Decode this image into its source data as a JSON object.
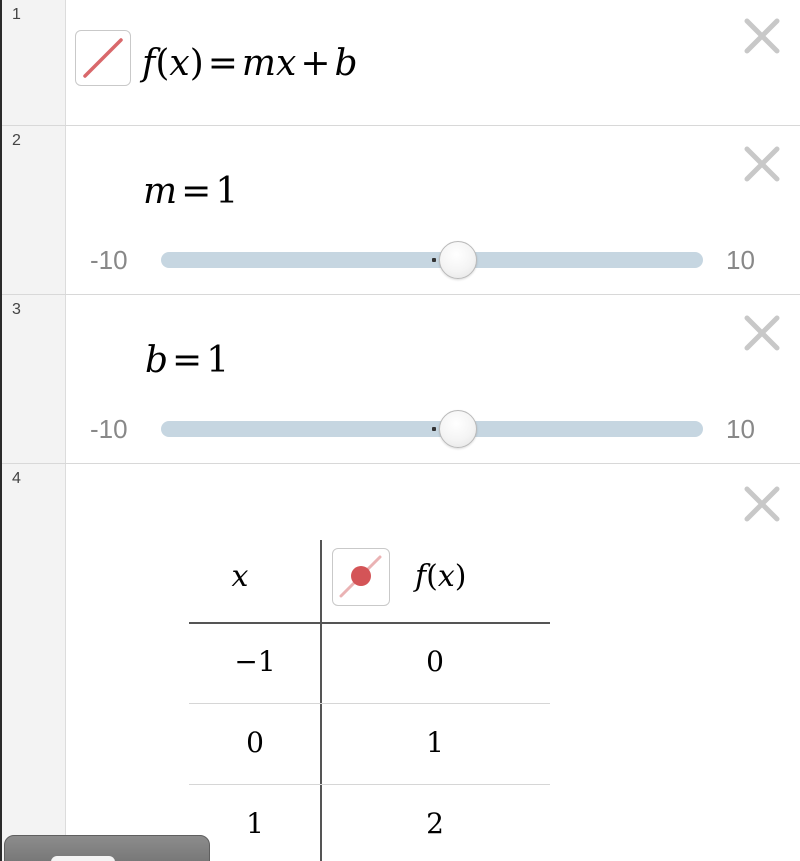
{
  "expressions": [
    {
      "number": "1",
      "func_name": "f",
      "var": "x",
      "equals": "=",
      "m": "m",
      "x2": "x",
      "plus": "+",
      "b": "b",
      "color": "#d9686b",
      "icon": "line-style-icon"
    },
    {
      "number": "2",
      "var": "m",
      "equals": "=",
      "value": "1",
      "slider": {
        "min": "-10",
        "max": "10",
        "current": 1
      }
    },
    {
      "number": "3",
      "var": "b",
      "equals": "=",
      "value": "1",
      "slider": {
        "min": "-10",
        "max": "10",
        "current": 1
      }
    },
    {
      "number": "4",
      "table": {
        "col1_header": "x",
        "col2_func": "f",
        "col2_var": "x",
        "point_color": "#d45457",
        "icon": "point-style-icon",
        "rows": [
          {
            "x": "−1",
            "fx": "0"
          },
          {
            "x": "0",
            "fx": "1"
          },
          {
            "x": "1",
            "fx": "2"
          }
        ]
      }
    }
  ],
  "icons": {
    "delete": "close-icon"
  },
  "colors": {
    "slider_track": "#c6d6e1",
    "gutter": "#f3f3f3",
    "row_border": "#d8d8d8"
  }
}
